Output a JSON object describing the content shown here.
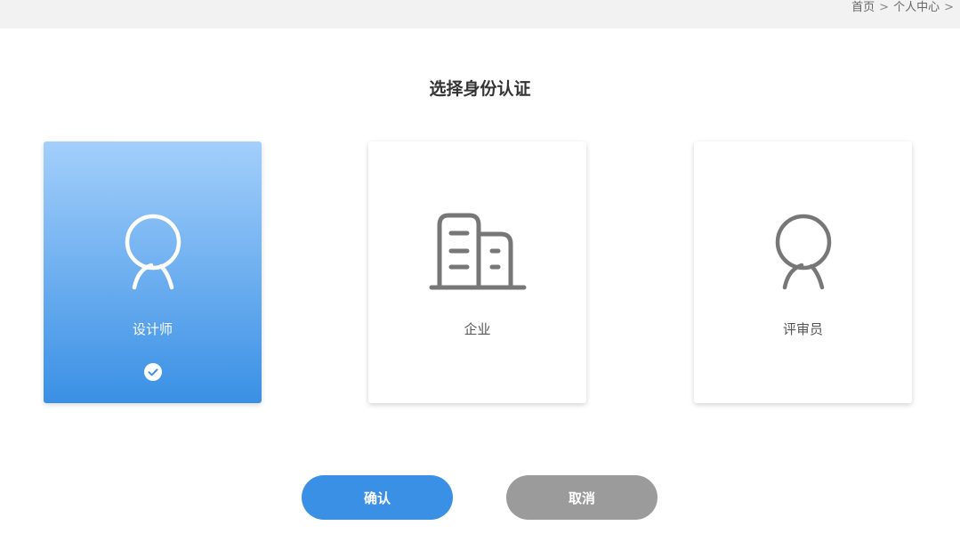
{
  "breadcrumb": {
    "home": "首页",
    "separator": ">",
    "current": "个人中心",
    "trailing_separator": ">"
  },
  "page": {
    "title": "选择身份认证"
  },
  "cards": [
    {
      "label": "设计师",
      "icon": "user-icon",
      "selected": true
    },
    {
      "label": "企业",
      "icon": "building-icon",
      "selected": false
    },
    {
      "label": "评审员",
      "icon": "user-icon",
      "selected": false
    }
  ],
  "buttons": {
    "confirm_label": "确认",
    "cancel_label": "取消"
  },
  "colors": {
    "accent": "#3a90e5",
    "selected_gradient_top": "#a3cffb",
    "cancel_gray": "#9b9b9b",
    "icon_gray": "#777777",
    "topbar_bg": "#f2f2f2"
  }
}
